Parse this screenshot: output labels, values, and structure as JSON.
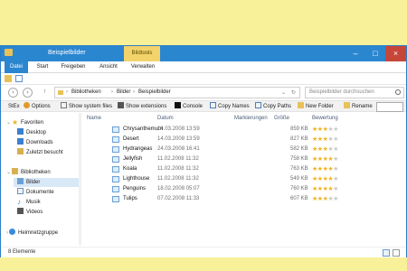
{
  "window": {
    "title": "Beispielbilder",
    "context_tab": "Bildtools",
    "minimize": "–",
    "maximize": "□",
    "close": "×"
  },
  "ribbon_tabs": [
    "Datei",
    "Start",
    "Freigeben",
    "Ansicht",
    "Verwalten"
  ],
  "navigation": {
    "back": "‹",
    "forward": "›",
    "up": "↑",
    "breadcrumb": [
      "Bibliotheken",
      "Bilder",
      "Beispielbilder"
    ],
    "search_placeholder": "Beispielbilder durchsuchen"
  },
  "toolbar": {
    "stexx": "StEx",
    "options": "Options",
    "show_system_files": "Show system files",
    "show_extensions": "Show extensions",
    "console": "Console",
    "copy_names": "Copy Names",
    "copy_paths": "Copy Paths",
    "new_folder": "New Folder",
    "rename": "Rename"
  },
  "sidebar": {
    "favorites": "Favoriten",
    "desktop": "Desktop",
    "downloads": "Downloads",
    "recent": "Zuletzt besucht",
    "libraries": "Bibliotheken",
    "pictures": "Bilder",
    "documents": "Dokumente",
    "music": "Musik",
    "videos": "Videos",
    "homegroup": "Heimnetzgruppe"
  },
  "columns": {
    "name": "Name",
    "date": "Datum",
    "tags": "Markierungen",
    "size": "Größe",
    "rating": "Bewertung"
  },
  "files": [
    {
      "name": "Chrysanthemum",
      "date": "14.03.2008 13:59",
      "size": "859 KB",
      "rating": 3
    },
    {
      "name": "Desert",
      "date": "14.03.2008 13:59",
      "size": "827 KB",
      "rating": 3
    },
    {
      "name": "Hydrangeas",
      "date": "24.03.2008 16:41",
      "size": "582 KB",
      "rating": 3
    },
    {
      "name": "Jellyfish",
      "date": "11.02.2008 11:32",
      "size": "758 KB",
      "rating": 4
    },
    {
      "name": "Koala",
      "date": "11.02.2008 11:32",
      "size": "763 KB",
      "rating": 4
    },
    {
      "name": "Lighthouse",
      "date": "11.02.2008 11:32",
      "size": "549 KB",
      "rating": 4
    },
    {
      "name": "Penguins",
      "date": "18.02.2008 05:07",
      "size": "760 KB",
      "rating": 4
    },
    {
      "name": "Tulips",
      "date": "07.02.2008 11:33",
      "size": "607 KB",
      "rating": 3
    }
  ],
  "status": {
    "item_count": "8 Elemente"
  },
  "colors": {
    "accent": "#2b86d0",
    "context_tab": "#f3d46a",
    "star": "#f0b323",
    "background": "#f8f19a"
  }
}
